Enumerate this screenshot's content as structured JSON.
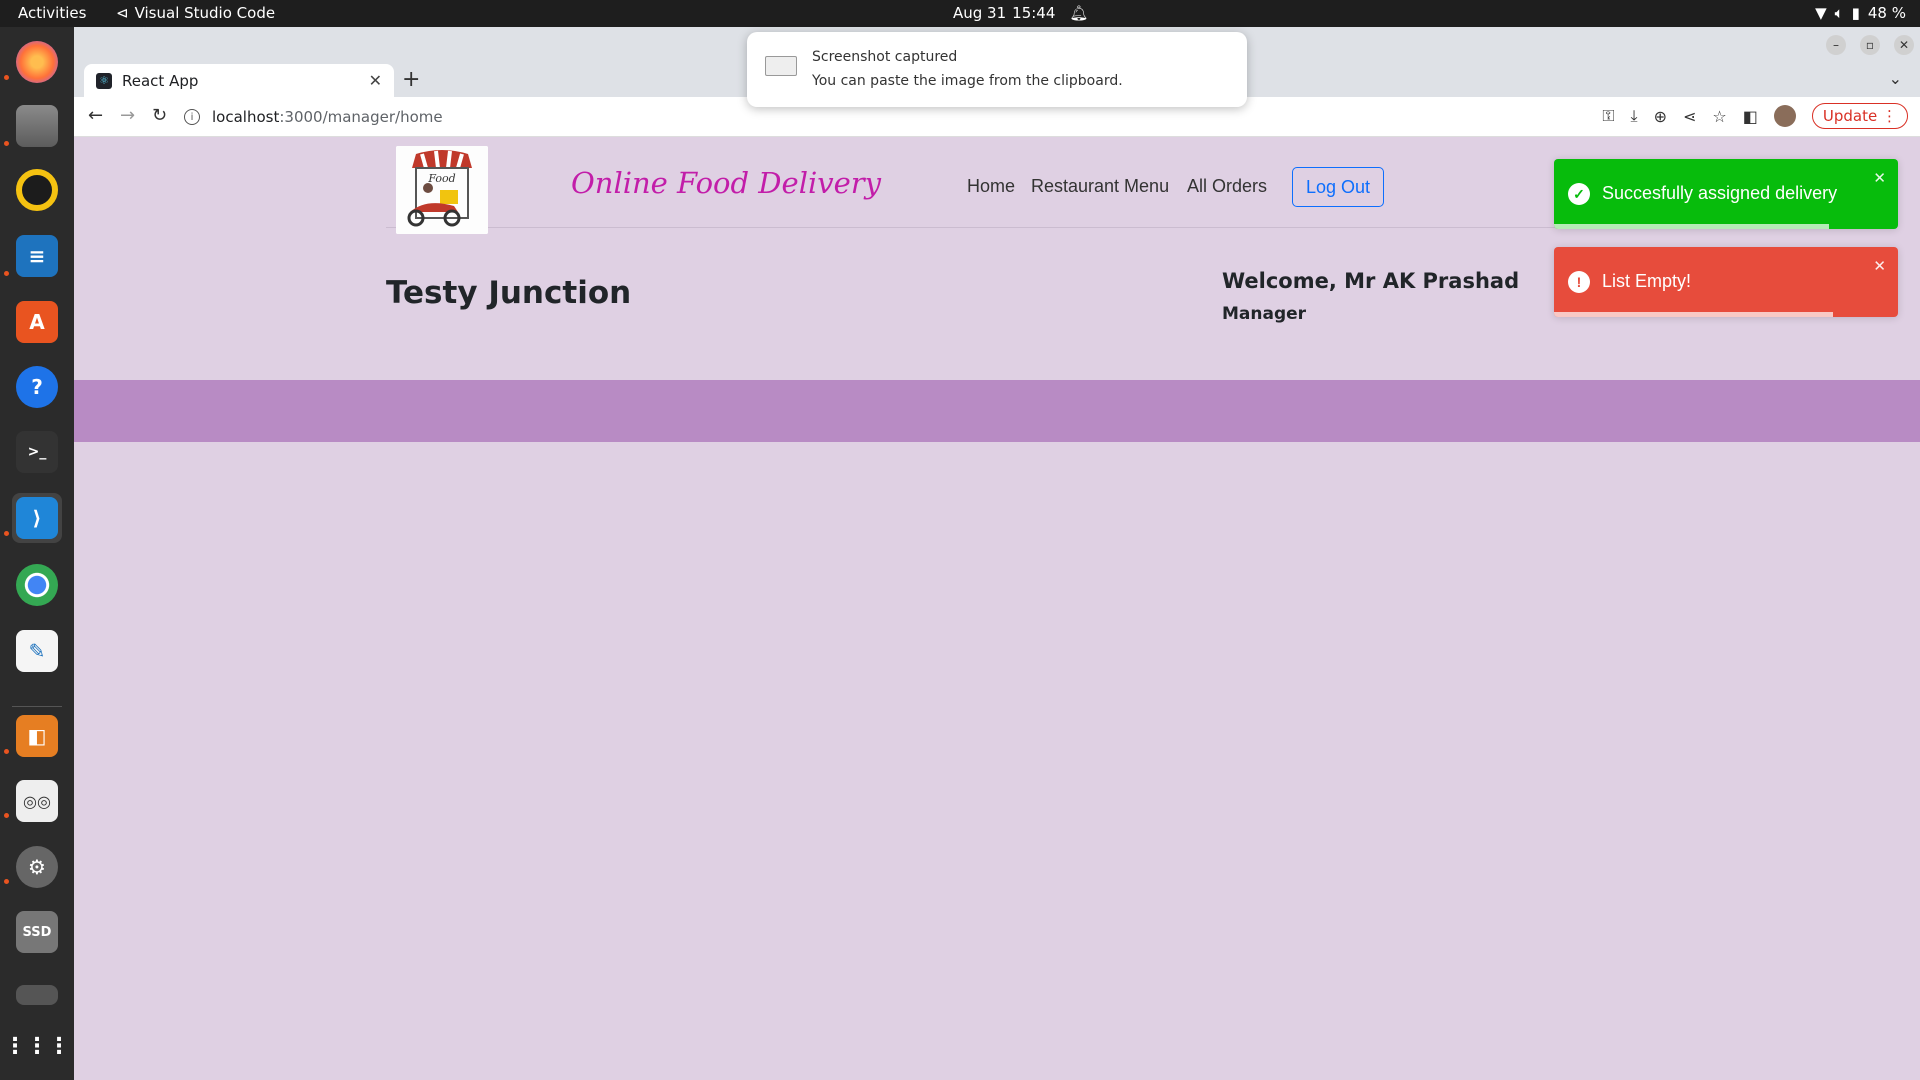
{
  "topbar": {
    "activities": "Activities",
    "app_name": "Visual Studio Code",
    "date": "Aug 31",
    "time": "15:44",
    "battery": "48 %"
  },
  "dock": {
    "items": [
      "firefox-icon",
      "files-icon",
      "rhythmbox-icon",
      "writer-icon",
      "software-icon",
      "help-icon",
      "terminal-icon",
      "vscode-icon",
      "chrome-icon",
      "text-editor-icon",
      "impress-icon",
      "document-viewer-icon",
      "settings-icon",
      "ssd-icon",
      "trash-icon"
    ]
  },
  "browser": {
    "tab_title": "React App",
    "url_host": "localhost",
    "url_path": ":3000/manager/home",
    "update_label": "Update"
  },
  "notification": {
    "title": "Screenshot captured",
    "body": "You can paste the image from the clipboard."
  },
  "page": {
    "brand": "Online Food Delivery",
    "nav": {
      "home": "Home",
      "menu": "Restaurant Menu",
      "orders": "All Orders",
      "logout": "Log Out"
    },
    "restaurant_name": "Testy Junction",
    "welcome": "Welcome, Mr AK Prashad",
    "role": "Manager"
  },
  "toasts": {
    "success": {
      "message": "Succesfully assigned delivery",
      "color": "#07bc0c",
      "progress": 0.8
    },
    "error": {
      "message": "List Empty!",
      "color": "#e74c3c",
      "progress": 0.81
    }
  },
  "colors": {
    "page_bg": "#dfd0e3",
    "band": "#b88bc4",
    "brand": "#c21da9",
    "primary": "#0d6efd"
  }
}
